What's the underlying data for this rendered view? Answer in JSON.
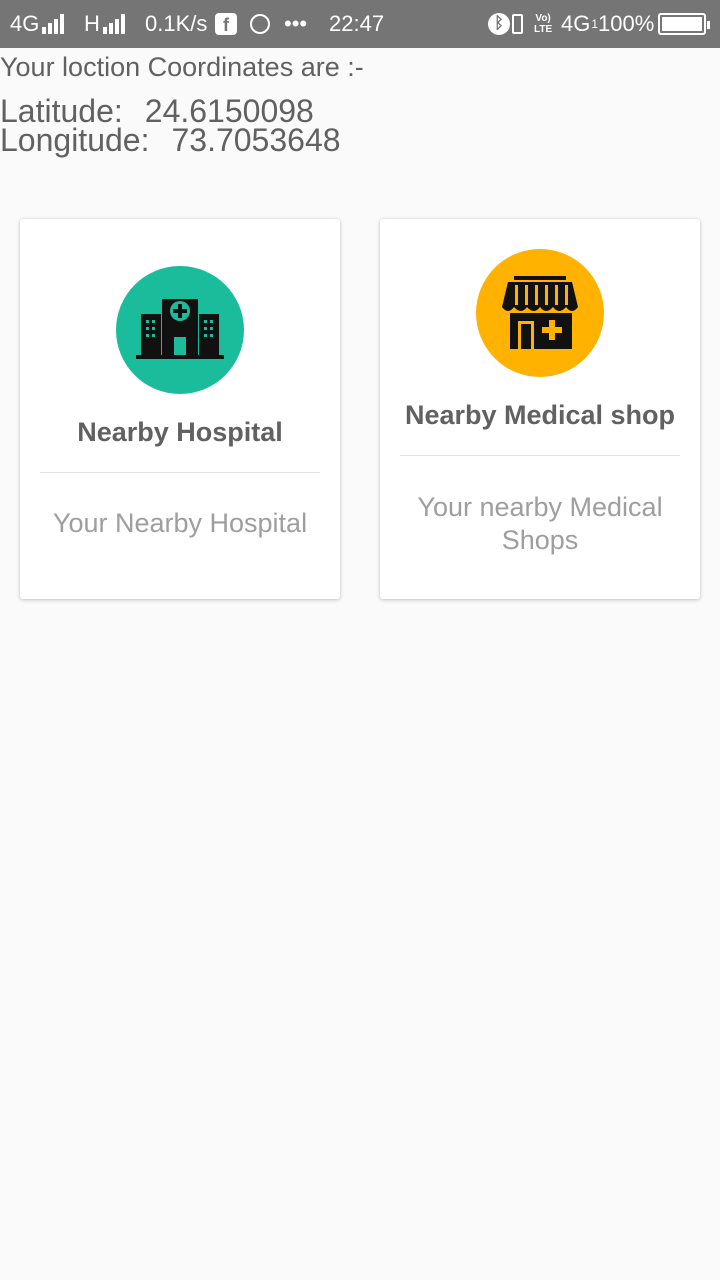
{
  "status_bar": {
    "network_1": "4G",
    "network_2": "H",
    "speed": "0.1K/s",
    "more": "•••",
    "time": "22:47",
    "volte_top": "Vo)",
    "volte_bottom": "LTE",
    "network_3": "4G",
    "sim_index": "1",
    "battery": "100%"
  },
  "location": {
    "heading": "Your loction Coordinates are :-",
    "latitude_label": "Latitude:",
    "latitude_value": "24.6150098",
    "longitude_label": "Longitude:",
    "longitude_value": "73.7053648"
  },
  "cards": [
    {
      "title": "Nearby Hospital",
      "description": "Your Nearby Hospital",
      "icon": "hospital-icon",
      "color": "#1abc9c"
    },
    {
      "title": "Nearby Medical shop",
      "description": "Your nearby Medical Shops",
      "icon": "medical-shop-icon",
      "color": "#ffb300"
    }
  ],
  "colors": {
    "status_bar": "#757575",
    "background": "#fafafa",
    "text_primary": "#616161",
    "text_secondary": "#9e9e9e"
  }
}
